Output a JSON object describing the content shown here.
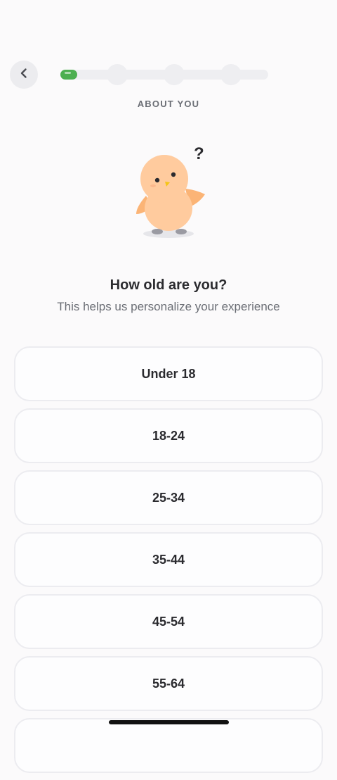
{
  "header": {
    "back_icon": "chevron-left-icon",
    "progress_fraction": 0.08,
    "steps_total": 4
  },
  "section_label": "ABOUT YOU",
  "mascot": {
    "icon": "confused-bird-mascot",
    "question_mark": "?"
  },
  "question": {
    "title": "How old are you?",
    "subtitle": "This helps us personalize your experience"
  },
  "options": [
    {
      "label": "Under 18"
    },
    {
      "label": "18-24"
    },
    {
      "label": "25-34"
    },
    {
      "label": "35-44"
    },
    {
      "label": "45-54"
    },
    {
      "label": "55-64"
    },
    {
      "label": ""
    }
  ],
  "colors": {
    "accent": "#4caf50",
    "background": "#fbfafb",
    "text_primary": "#2b2b2f",
    "text_secondary": "#6b6e75"
  }
}
